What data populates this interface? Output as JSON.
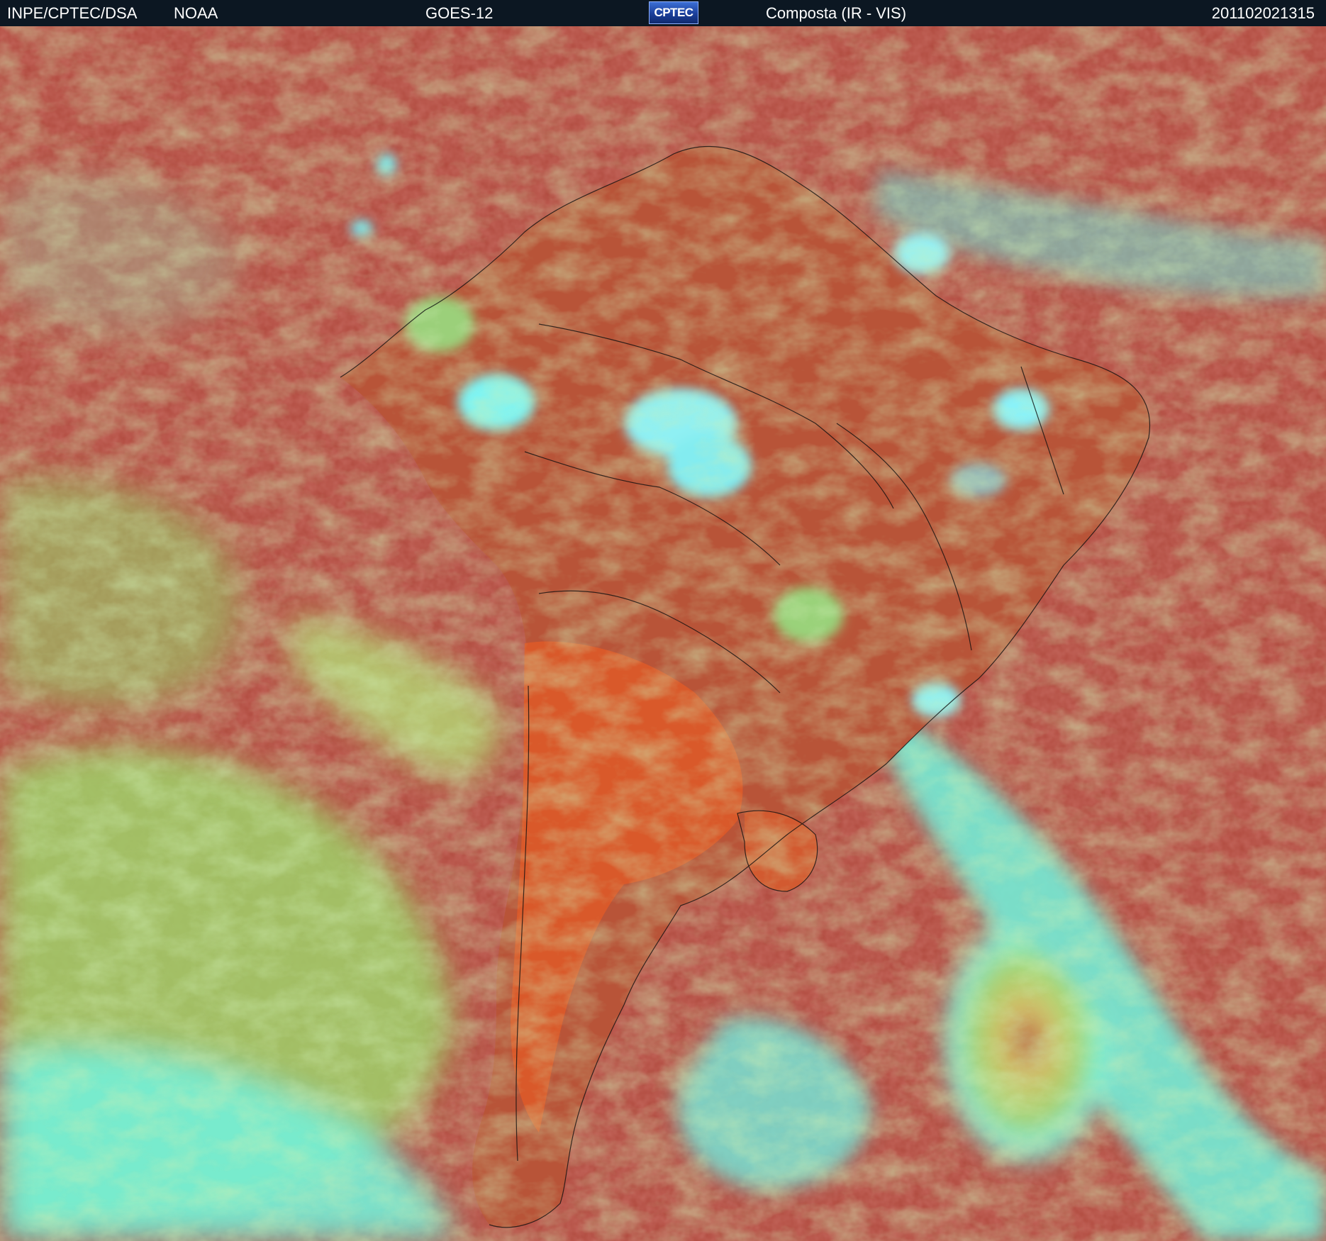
{
  "header": {
    "source": "INPE/CPTEC/DSA",
    "agency": "NOAA",
    "satellite": "GOES-12",
    "logo_text": "CPTEC",
    "product": "Composta (IR - VIS)",
    "timestamp": "201102021315"
  },
  "colors": {
    "header_bg": "#0c1722",
    "header_text": "#ffffff",
    "ocean_clear": "#b44a3c",
    "land_clear": "#d9582a",
    "low_cloud": "#9ed26a",
    "high_cloud": "#6ff0e6",
    "cold_deep_cloud": "#8aa8ff",
    "boundary_lines": "#101010"
  }
}
